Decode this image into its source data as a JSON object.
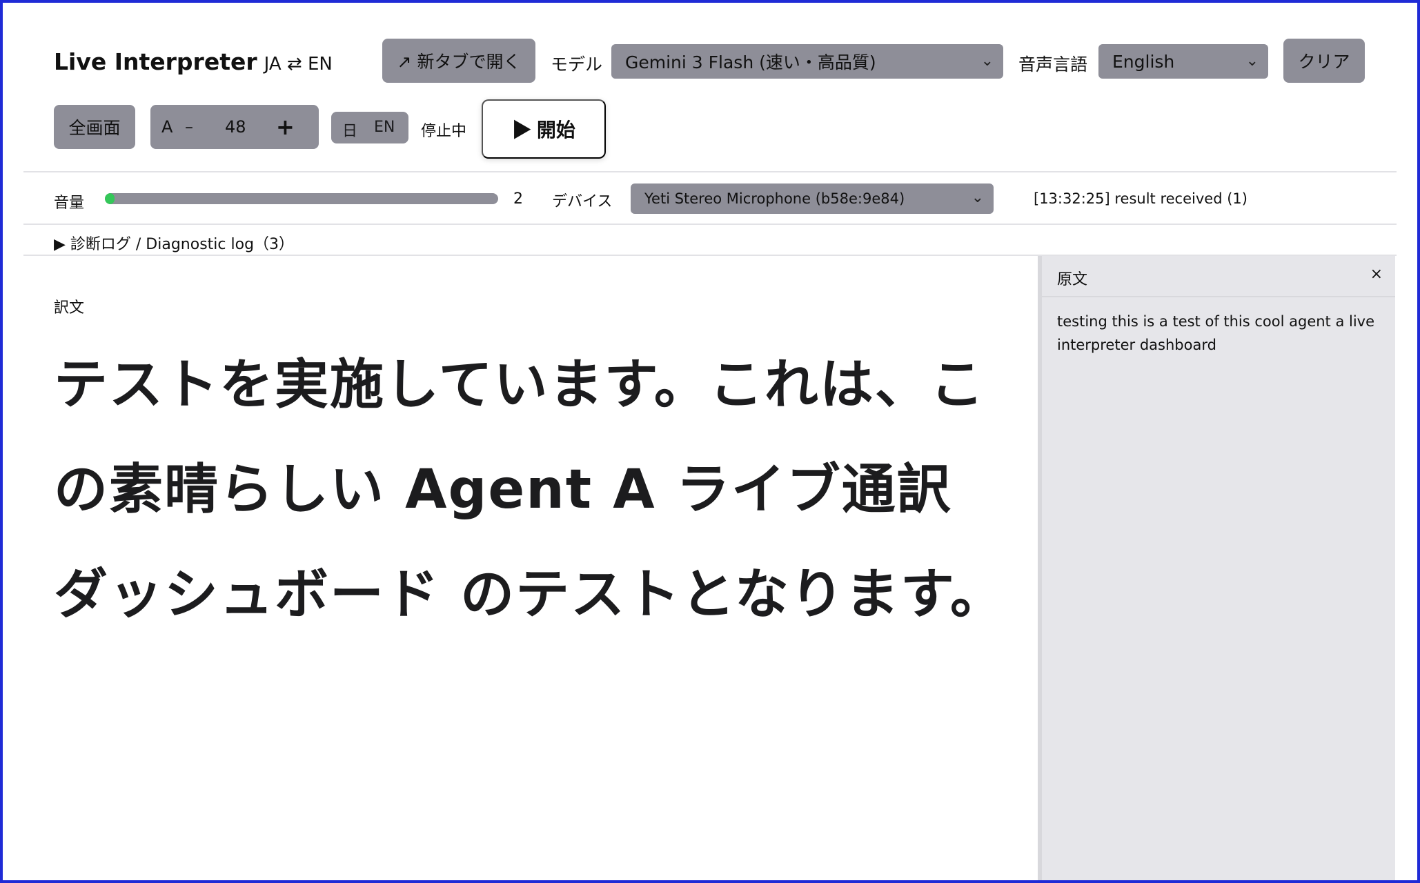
{
  "header": {
    "title": "Live Interpreter",
    "title_sub": "JA ⇄ EN",
    "open_new_tab_label": "↗ 新タブで開く",
    "model_label": "モデル",
    "model_value": "Gemini 3 Flash (速い・高品質)",
    "voice_lang_label": "音声言語",
    "voice_lang_value": "English",
    "clear_label": "クリア"
  },
  "toolbar": {
    "fullscreen_label": "全画面",
    "font_label": "A",
    "font_minus": "–",
    "font_size": "48",
    "font_plus": "+",
    "lang_ja": "日",
    "lang_en": "EN",
    "status": "停止中",
    "start_label": "▶ 開始"
  },
  "meter": {
    "volume_label": "音量",
    "level_fraction": 0.02,
    "level_value": "2",
    "device_label": "デバイス",
    "device_value": "Yeti Stereo Microphone (b58e:9e84)",
    "log_status": "[13:32:25] result received (1)"
  },
  "diagnostic": {
    "label": "▶ 診断ログ / Diagnostic log（3）"
  },
  "translation": {
    "label": "訳文",
    "text": "テストを実施しています。これは、この素晴らしい Agent A ライブ通訳 ダッシュボード のテストとなります。"
  },
  "source": {
    "title": "原文",
    "close": "×",
    "text": "testing this is a test of this cool agent a live interpreter dashboard"
  },
  "colors": {
    "accent_border": "#1f2bd6",
    "control_gray": "#8e8e98",
    "meter_green": "#34c759",
    "side_panel": "#e6e6ea"
  }
}
